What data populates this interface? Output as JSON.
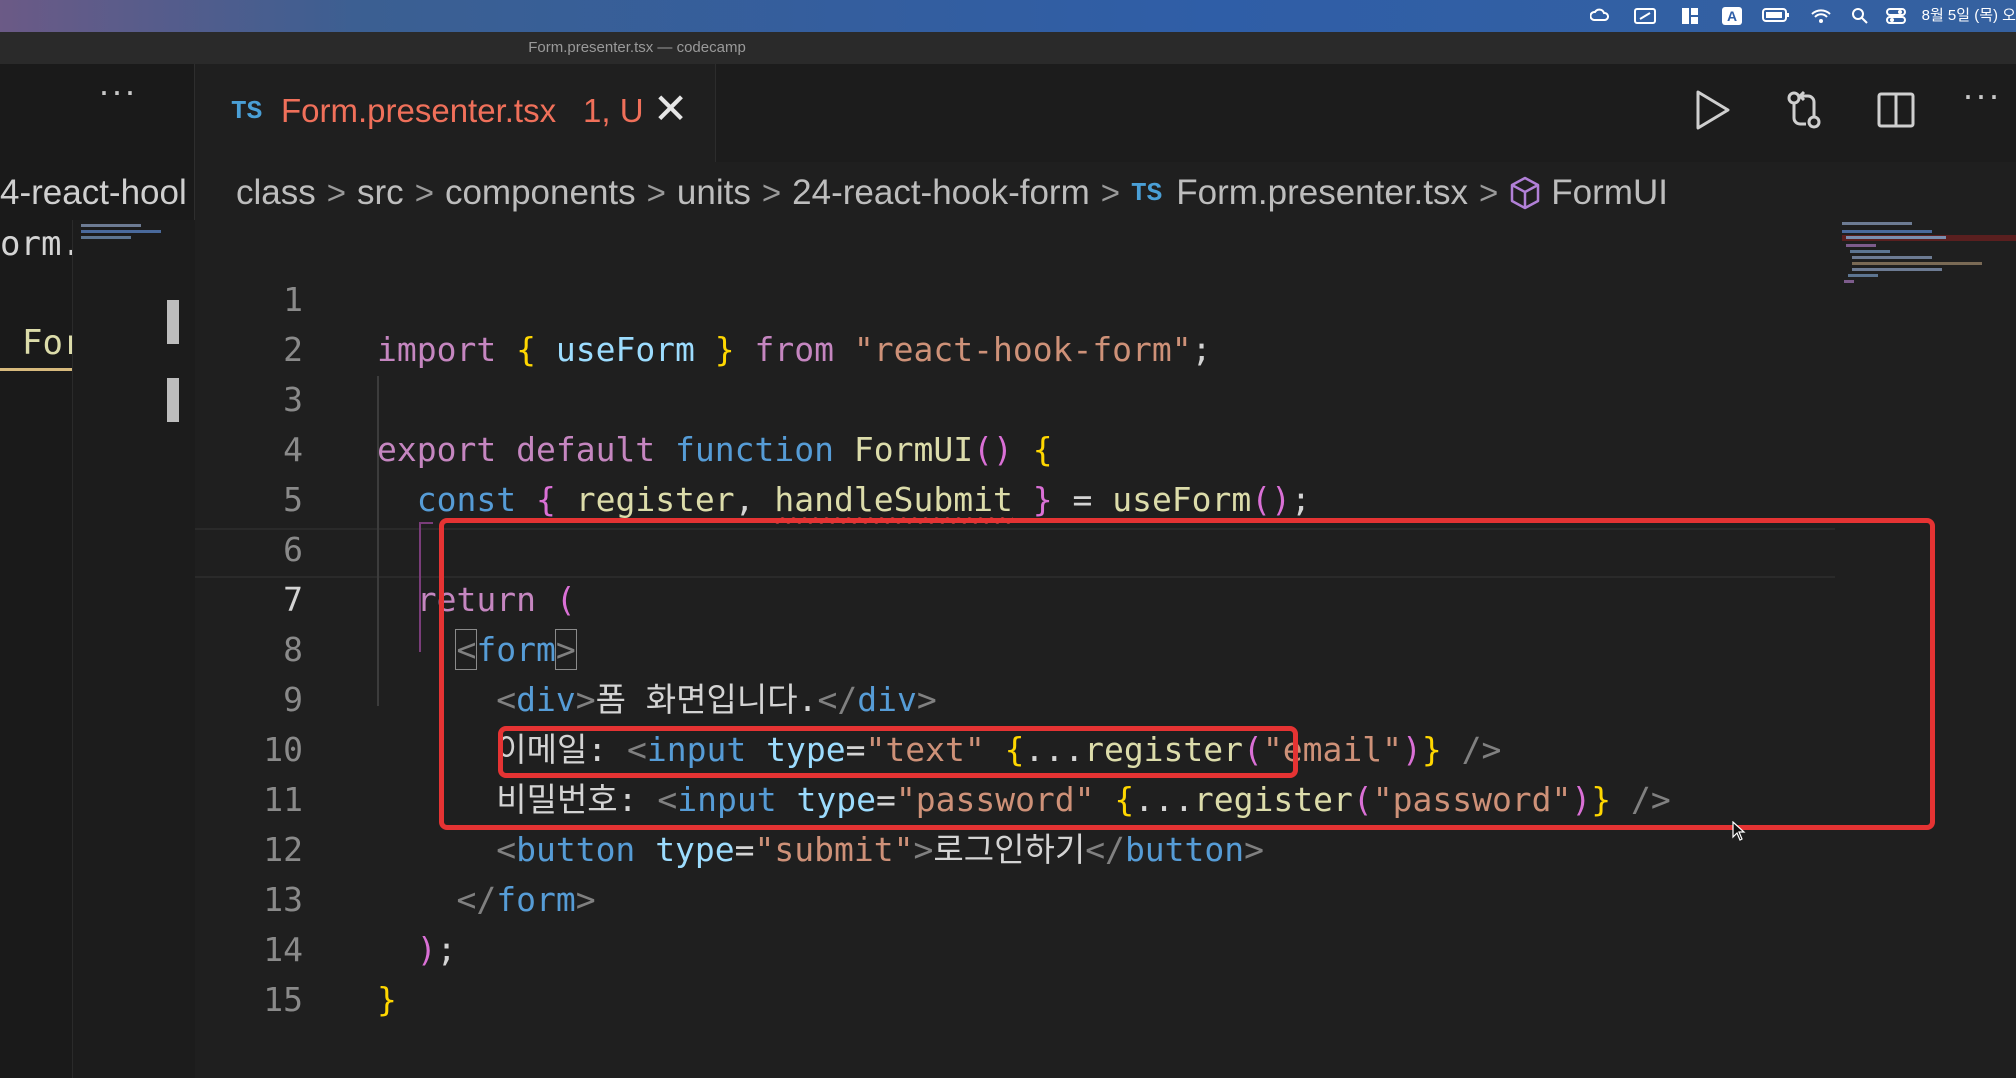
{
  "menubar": {
    "icons": [
      "creative-cloud-icon",
      "screen-share-icon",
      "dashboard-icon",
      "keyboard-input-icon",
      "battery-icon",
      "wifi-icon",
      "spotlight-search-icon",
      "control-center-icon"
    ],
    "input_letter": "A",
    "clock": "8월 5일 (목) 오"
  },
  "window": {
    "title": "Form.presenter.tsx — codecamp"
  },
  "tab": {
    "lang_badge": "TS",
    "filename": "Form.presenter.tsx",
    "status": "1, U"
  },
  "left_pane": {
    "breadcrumb_fragment": "4-react-hool",
    "code_fragment": "orm.",
    "open_item": "For"
  },
  "breadcrumb": {
    "items": [
      "class",
      "src",
      "components",
      "units",
      "24-react-hook-form"
    ],
    "file_badge": "TS",
    "file": "Form.presenter.tsx",
    "symbol": "FormUI"
  },
  "editor": {
    "line_numbers": [
      "1",
      "2",
      "3",
      "4",
      "5",
      "6",
      "7",
      "8",
      "9",
      "10",
      "11",
      "12",
      "13",
      "14",
      "15"
    ],
    "active_line": "7",
    "code_lines": [
      "import { useForm } from \"react-hook-form\";",
      "",
      "export default function FormUI() {",
      "  const { register, handleSubmit } = useForm();",
      "",
      "  return (",
      "    <form>",
      "      <div>폼 화면입니다.</div>",
      "      이메일: <input type=\"text\" {...register(\"email\")} />",
      "      비밀번호: <input type=\"password\" {...register(\"password\")} />",
      "      <button type=\"submit\">로그인하기</button>",
      "    </form>",
      "  );",
      "}",
      ""
    ]
  },
  "annotation_color": "#e53333"
}
